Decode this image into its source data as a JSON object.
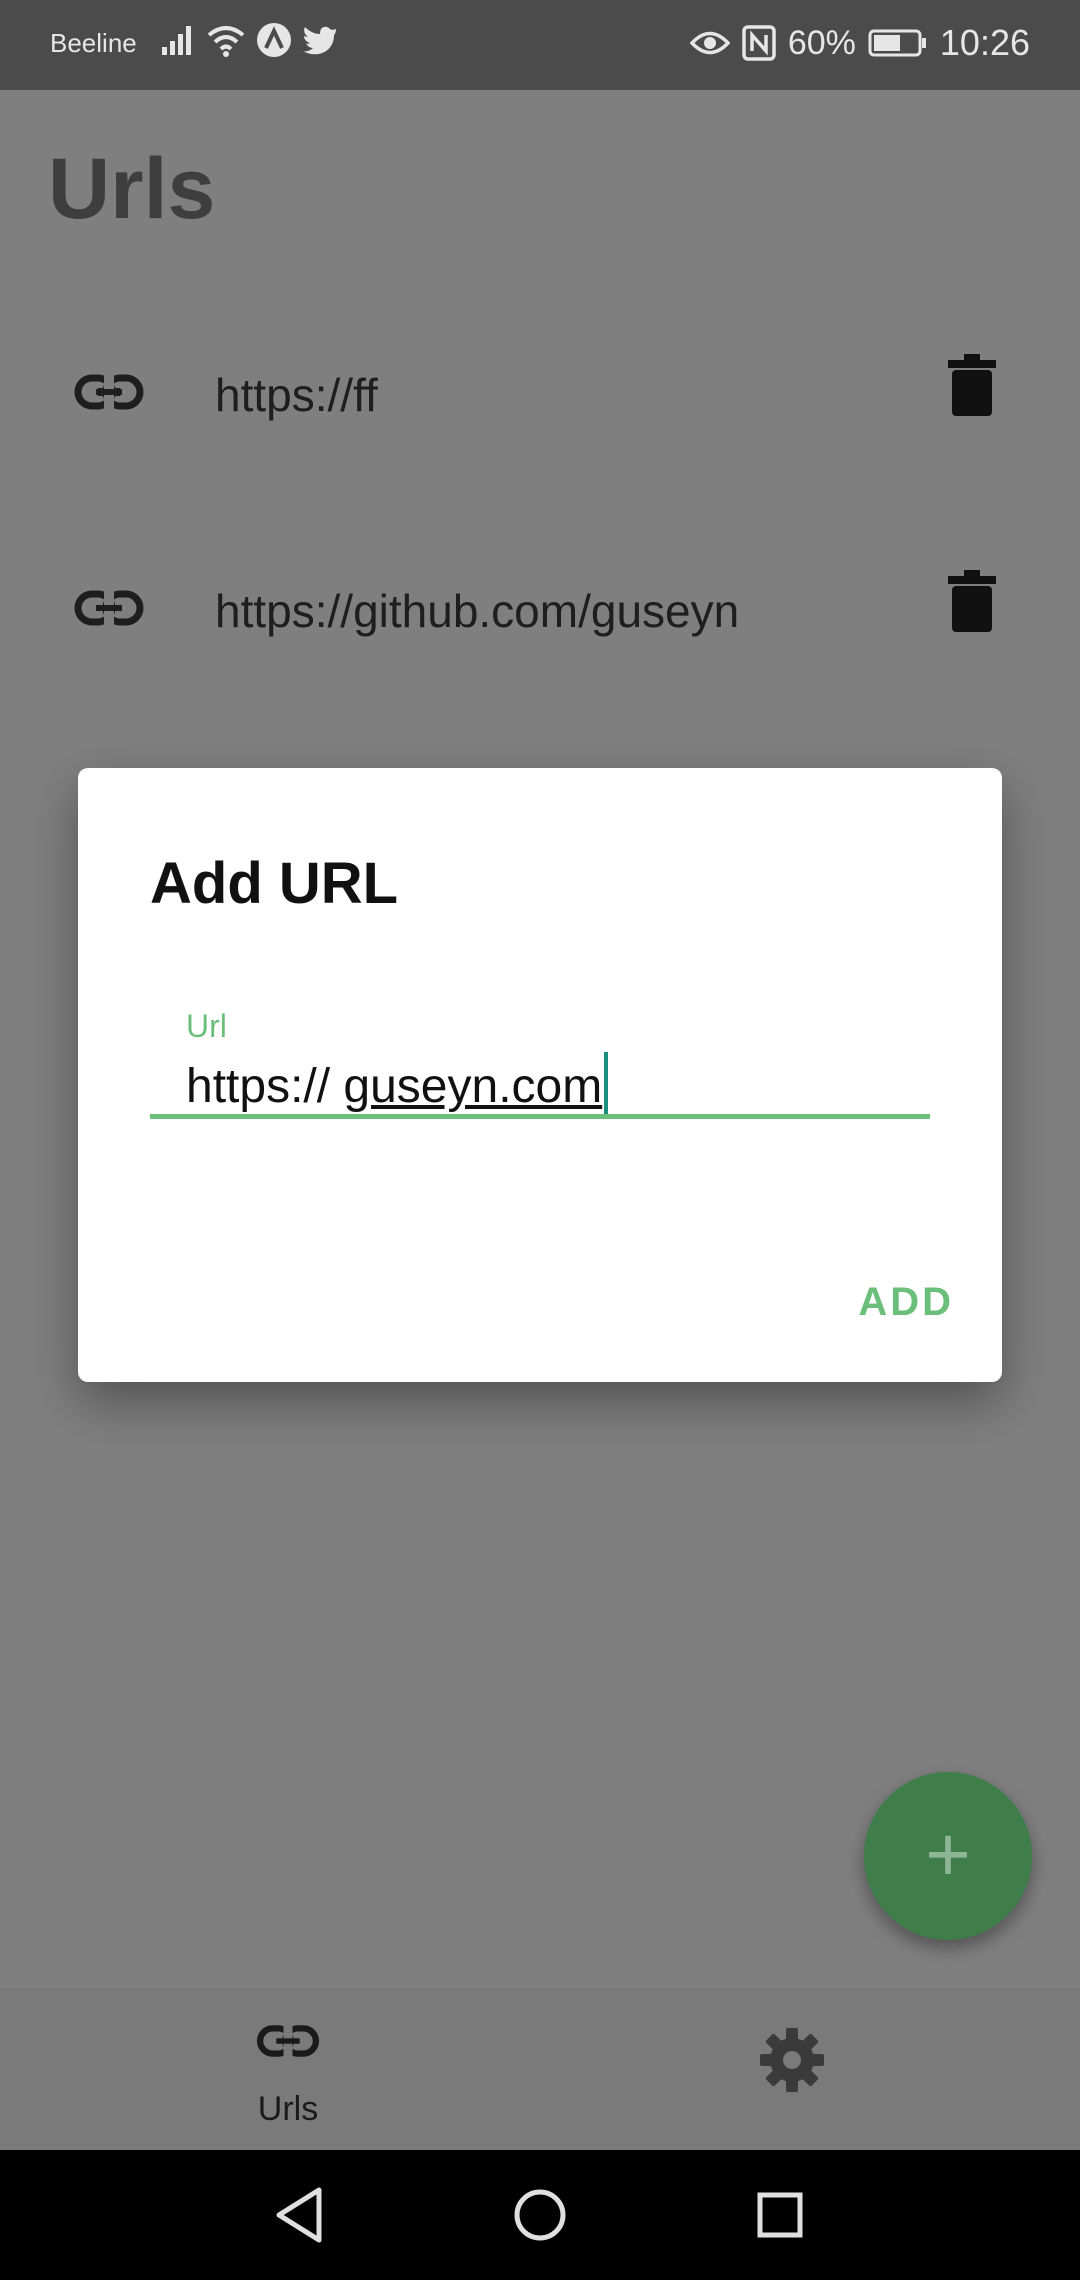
{
  "status_bar": {
    "carrier": "Beeline",
    "battery_percent": "60%",
    "time": "10:26"
  },
  "page": {
    "title": "Urls",
    "items": [
      {
        "url": "https://ff"
      },
      {
        "url": "https://github.com/guseyn"
      }
    ]
  },
  "dialog": {
    "title": "Add URL",
    "field_label": "Url",
    "field_value_prefix": "https:// ",
    "field_value_rest": "guseyn.com",
    "add_label": "ADD"
  },
  "fab": {
    "label": "+"
  },
  "bottom_nav": {
    "items": [
      {
        "label": "Urls",
        "icon": "link-icon"
      },
      {
        "label": "",
        "icon": "gear-icon"
      }
    ]
  },
  "colors": {
    "accent": "#6cbf7a",
    "fab": "#3f7e4a",
    "scrim": "#7f7f7f"
  }
}
